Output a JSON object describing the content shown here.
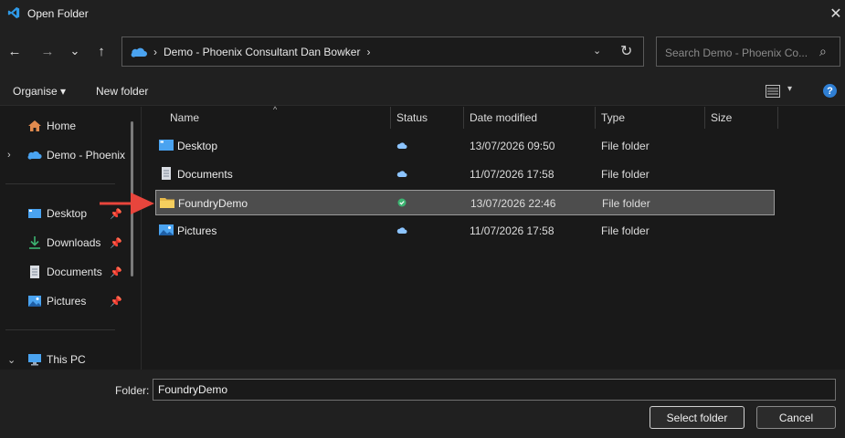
{
  "window": {
    "title": "Open Folder",
    "close_glyph": "✕"
  },
  "nav": {
    "back": "←",
    "forward": "→",
    "recent": "⌄",
    "up": "↑",
    "address": {
      "chevron": "›",
      "path": "Demo - Phoenix Consultant Dan Bowker",
      "trail_chevron": "›",
      "dropdown": "⌄",
      "refresh": "↻"
    },
    "search": {
      "placeholder": "Search Demo - Phoenix Co...",
      "icon": "⌕"
    }
  },
  "toolbar": {
    "organise": "Organise ▾",
    "new_folder": "New folder",
    "view_dropdown": "▾",
    "help": "?"
  },
  "sidebar": {
    "items": [
      {
        "label": "Home",
        "icon": "home-icon",
        "pinned": false
      },
      {
        "label": "Demo - Phoenix",
        "icon": "onedrive-icon",
        "expand": "›"
      },
      {
        "label": "Desktop",
        "icon": "desktop-icon",
        "pin": "📌"
      },
      {
        "label": "Downloads",
        "icon": "download-icon",
        "pin": "📌"
      },
      {
        "label": "Documents",
        "icon": "documents-icon",
        "pin": "📌"
      },
      {
        "label": "Pictures",
        "icon": "pictures-icon",
        "pin": "📌"
      },
      {
        "label": "This PC",
        "icon": "pc-icon",
        "expand": "⌄"
      }
    ]
  },
  "columns": {
    "name": "Name",
    "status": "Status",
    "date": "Date modified",
    "type": "Type",
    "size": "Size",
    "sort_caret": "^"
  },
  "files": [
    {
      "name": "Desktop",
      "icon": "desktop-icon",
      "status": "cloud",
      "date": "13/07/2026 09:50",
      "type": "File folder"
    },
    {
      "name": "Documents",
      "icon": "documents-icon",
      "status": "cloud",
      "date": "11/07/2026 17:58",
      "type": "File folder"
    },
    {
      "name": "FoundryDemo",
      "icon": "folder-icon",
      "status": "synced",
      "date": "13/07/2026 22:46",
      "type": "File folder",
      "selected": true
    },
    {
      "name": "Pictures",
      "icon": "pictures-icon",
      "status": "cloud",
      "date": "11/07/2026 17:58",
      "type": "File folder"
    }
  ],
  "footer": {
    "folder_label": "Folder:",
    "folder_value": "FoundryDemo",
    "select_button": "Select folder",
    "cancel_button": "Cancel"
  },
  "colors": {
    "accent": "#2f7fd4",
    "annotation_arrow": "#e8453c",
    "synced": "#3cb371",
    "cloud": "#8cc4ff"
  }
}
